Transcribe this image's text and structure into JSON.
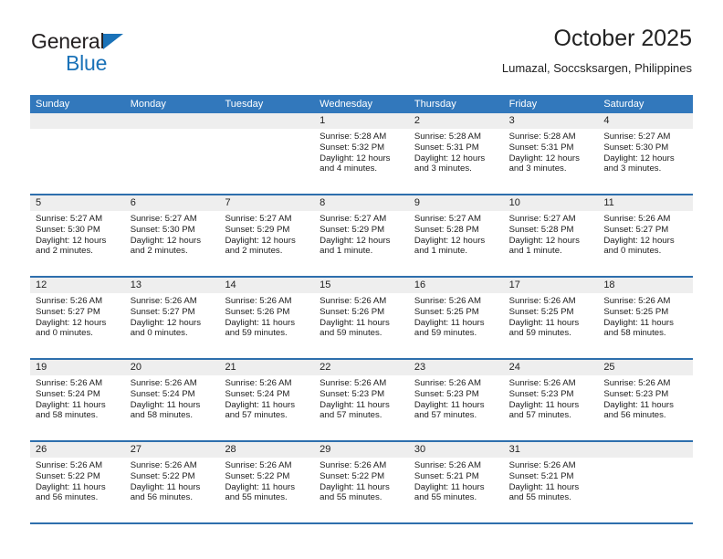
{
  "brand": {
    "name_part1": "General",
    "name_part2": "Blue",
    "triangle_color": "#1a72b8"
  },
  "header": {
    "title": "October 2025",
    "subtitle": "Lumazal, Soccsksargen, Philippines"
  },
  "theme": {
    "header_blue": "#3278bc",
    "row_rule_blue": "#2e6fad",
    "date_band_gray": "#eeeeee"
  },
  "weekday_headers": [
    "Sunday",
    "Monday",
    "Tuesday",
    "Wednesday",
    "Thursday",
    "Friday",
    "Saturday"
  ],
  "weeks": [
    [
      {
        "day": "",
        "sunrise": "",
        "sunset": "",
        "daylight1": "",
        "daylight2": ""
      },
      {
        "day": "",
        "sunrise": "",
        "sunset": "",
        "daylight1": "",
        "daylight2": ""
      },
      {
        "day": "",
        "sunrise": "",
        "sunset": "",
        "daylight1": "",
        "daylight2": ""
      },
      {
        "day": "1",
        "sunrise": "Sunrise: 5:28 AM",
        "sunset": "Sunset: 5:32 PM",
        "daylight1": "Daylight: 12 hours",
        "daylight2": "and 4 minutes."
      },
      {
        "day": "2",
        "sunrise": "Sunrise: 5:28 AM",
        "sunset": "Sunset: 5:31 PM",
        "daylight1": "Daylight: 12 hours",
        "daylight2": "and 3 minutes."
      },
      {
        "day": "3",
        "sunrise": "Sunrise: 5:28 AM",
        "sunset": "Sunset: 5:31 PM",
        "daylight1": "Daylight: 12 hours",
        "daylight2": "and 3 minutes."
      },
      {
        "day": "4",
        "sunrise": "Sunrise: 5:27 AM",
        "sunset": "Sunset: 5:30 PM",
        "daylight1": "Daylight: 12 hours",
        "daylight2": "and 3 minutes."
      }
    ],
    [
      {
        "day": "5",
        "sunrise": "Sunrise: 5:27 AM",
        "sunset": "Sunset: 5:30 PM",
        "daylight1": "Daylight: 12 hours",
        "daylight2": "and 2 minutes."
      },
      {
        "day": "6",
        "sunrise": "Sunrise: 5:27 AM",
        "sunset": "Sunset: 5:30 PM",
        "daylight1": "Daylight: 12 hours",
        "daylight2": "and 2 minutes."
      },
      {
        "day": "7",
        "sunrise": "Sunrise: 5:27 AM",
        "sunset": "Sunset: 5:29 PM",
        "daylight1": "Daylight: 12 hours",
        "daylight2": "and 2 minutes."
      },
      {
        "day": "8",
        "sunrise": "Sunrise: 5:27 AM",
        "sunset": "Sunset: 5:29 PM",
        "daylight1": "Daylight: 12 hours",
        "daylight2": "and 1 minute."
      },
      {
        "day": "9",
        "sunrise": "Sunrise: 5:27 AM",
        "sunset": "Sunset: 5:28 PM",
        "daylight1": "Daylight: 12 hours",
        "daylight2": "and 1 minute."
      },
      {
        "day": "10",
        "sunrise": "Sunrise: 5:27 AM",
        "sunset": "Sunset: 5:28 PM",
        "daylight1": "Daylight: 12 hours",
        "daylight2": "and 1 minute."
      },
      {
        "day": "11",
        "sunrise": "Sunrise: 5:26 AM",
        "sunset": "Sunset: 5:27 PM",
        "daylight1": "Daylight: 12 hours",
        "daylight2": "and 0 minutes."
      }
    ],
    [
      {
        "day": "12",
        "sunrise": "Sunrise: 5:26 AM",
        "sunset": "Sunset: 5:27 PM",
        "daylight1": "Daylight: 12 hours",
        "daylight2": "and 0 minutes."
      },
      {
        "day": "13",
        "sunrise": "Sunrise: 5:26 AM",
        "sunset": "Sunset: 5:27 PM",
        "daylight1": "Daylight: 12 hours",
        "daylight2": "and 0 minutes."
      },
      {
        "day": "14",
        "sunrise": "Sunrise: 5:26 AM",
        "sunset": "Sunset: 5:26 PM",
        "daylight1": "Daylight: 11 hours",
        "daylight2": "and 59 minutes."
      },
      {
        "day": "15",
        "sunrise": "Sunrise: 5:26 AM",
        "sunset": "Sunset: 5:26 PM",
        "daylight1": "Daylight: 11 hours",
        "daylight2": "and 59 minutes."
      },
      {
        "day": "16",
        "sunrise": "Sunrise: 5:26 AM",
        "sunset": "Sunset: 5:25 PM",
        "daylight1": "Daylight: 11 hours",
        "daylight2": "and 59 minutes."
      },
      {
        "day": "17",
        "sunrise": "Sunrise: 5:26 AM",
        "sunset": "Sunset: 5:25 PM",
        "daylight1": "Daylight: 11 hours",
        "daylight2": "and 59 minutes."
      },
      {
        "day": "18",
        "sunrise": "Sunrise: 5:26 AM",
        "sunset": "Sunset: 5:25 PM",
        "daylight1": "Daylight: 11 hours",
        "daylight2": "and 58 minutes."
      }
    ],
    [
      {
        "day": "19",
        "sunrise": "Sunrise: 5:26 AM",
        "sunset": "Sunset: 5:24 PM",
        "daylight1": "Daylight: 11 hours",
        "daylight2": "and 58 minutes."
      },
      {
        "day": "20",
        "sunrise": "Sunrise: 5:26 AM",
        "sunset": "Sunset: 5:24 PM",
        "daylight1": "Daylight: 11 hours",
        "daylight2": "and 58 minutes."
      },
      {
        "day": "21",
        "sunrise": "Sunrise: 5:26 AM",
        "sunset": "Sunset: 5:24 PM",
        "daylight1": "Daylight: 11 hours",
        "daylight2": "and 57 minutes."
      },
      {
        "day": "22",
        "sunrise": "Sunrise: 5:26 AM",
        "sunset": "Sunset: 5:23 PM",
        "daylight1": "Daylight: 11 hours",
        "daylight2": "and 57 minutes."
      },
      {
        "day": "23",
        "sunrise": "Sunrise: 5:26 AM",
        "sunset": "Sunset: 5:23 PM",
        "daylight1": "Daylight: 11 hours",
        "daylight2": "and 57 minutes."
      },
      {
        "day": "24",
        "sunrise": "Sunrise: 5:26 AM",
        "sunset": "Sunset: 5:23 PM",
        "daylight1": "Daylight: 11 hours",
        "daylight2": "and 57 minutes."
      },
      {
        "day": "25",
        "sunrise": "Sunrise: 5:26 AM",
        "sunset": "Sunset: 5:23 PM",
        "daylight1": "Daylight: 11 hours",
        "daylight2": "and 56 minutes."
      }
    ],
    [
      {
        "day": "26",
        "sunrise": "Sunrise: 5:26 AM",
        "sunset": "Sunset: 5:22 PM",
        "daylight1": "Daylight: 11 hours",
        "daylight2": "and 56 minutes."
      },
      {
        "day": "27",
        "sunrise": "Sunrise: 5:26 AM",
        "sunset": "Sunset: 5:22 PM",
        "daylight1": "Daylight: 11 hours",
        "daylight2": "and 56 minutes."
      },
      {
        "day": "28",
        "sunrise": "Sunrise: 5:26 AM",
        "sunset": "Sunset: 5:22 PM",
        "daylight1": "Daylight: 11 hours",
        "daylight2": "and 55 minutes."
      },
      {
        "day": "29",
        "sunrise": "Sunrise: 5:26 AM",
        "sunset": "Sunset: 5:22 PM",
        "daylight1": "Daylight: 11 hours",
        "daylight2": "and 55 minutes."
      },
      {
        "day": "30",
        "sunrise": "Sunrise: 5:26 AM",
        "sunset": "Sunset: 5:21 PM",
        "daylight1": "Daylight: 11 hours",
        "daylight2": "and 55 minutes."
      },
      {
        "day": "31",
        "sunrise": "Sunrise: 5:26 AM",
        "sunset": "Sunset: 5:21 PM",
        "daylight1": "Daylight: 11 hours",
        "daylight2": "and 55 minutes."
      },
      {
        "day": "",
        "sunrise": "",
        "sunset": "",
        "daylight1": "",
        "daylight2": ""
      }
    ]
  ]
}
